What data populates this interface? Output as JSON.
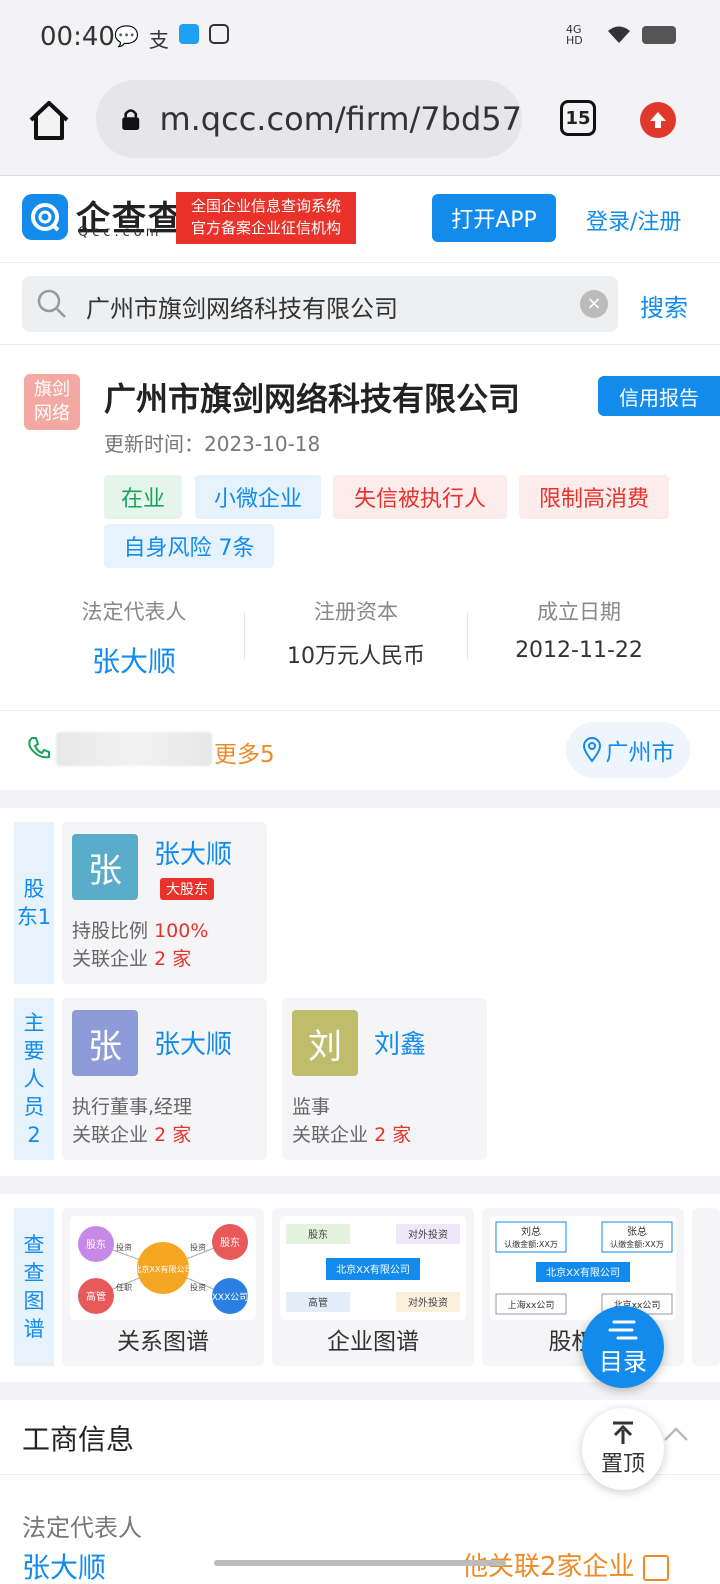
{
  "status_bar": {
    "time": "00:40",
    "network": "4G HD"
  },
  "browser": {
    "url": "m.qcc.com/firm/7bd57",
    "tab_count": "15"
  },
  "site": {
    "logo_text": "企查查",
    "logo_sub": "Qcc.com",
    "slogan_line1": "全国企业信息查询系统",
    "slogan_line2": "官方备案企业征信机构",
    "open_app": "打开APP",
    "login": "登录/注册"
  },
  "search": {
    "query": "广州市旗剑网络科技有限公司",
    "button": "搜索"
  },
  "company": {
    "logo_line1": "旗剑",
    "logo_line2": "网络",
    "name": "广州市旗剑网络科技有限公司",
    "credit_report": "信用报告",
    "update_label": "更新时间：",
    "update_date": "2023-10-18",
    "tags": [
      "在业",
      "小微企业",
      "失信被执行人",
      "限制高消费",
      "自身风险 7条"
    ],
    "legal_rep_label": "法定代表人",
    "legal_rep": "张大顺",
    "capital_label": "注册资本",
    "capital": "10万元人民币",
    "founded_label": "成立日期",
    "founded": "2012-11-22",
    "more_phones": "更多5",
    "city": "广州市"
  },
  "shareholders": {
    "label": "股\n东1",
    "items": [
      {
        "avatar": "张",
        "name": "张大顺",
        "badge": "大股东",
        "ratio_label": "持股比例",
        "ratio": "100%",
        "related_label": "关联企业",
        "related_count": "2 家"
      }
    ]
  },
  "key_people": {
    "label": "主\n要\n人\n员\n2",
    "items": [
      {
        "avatar": "张",
        "name": "张大顺",
        "role": "执行董事,经理",
        "related_label": "关联企业",
        "related_count": "2 家"
      },
      {
        "avatar": "刘",
        "name": "刘鑫",
        "role": "监事",
        "related_label": "关联企业",
        "related_count": "2 家"
      }
    ]
  },
  "graphs": {
    "label": "查\n查\n图\n谱",
    "items": [
      {
        "title": "关系图谱",
        "center": "北京XX有限公司",
        "n1": "股东",
        "n2": "高管",
        "n3": "股东",
        "n4": "XXX公司",
        "e1": "投资",
        "e2": "任职",
        "e3": "投资",
        "e4": "投资"
      },
      {
        "title": "企业图谱",
        "center": "北京XX有限公司",
        "n1": "股东",
        "n2": "对外投资",
        "n3": "高管",
        "n4": "对外投资"
      },
      {
        "title": "股权穿",
        "center": "北京XX有限公司",
        "n1": "刘总",
        "n1s": "认缴金额:XX万",
        "n2": "张总",
        "n2s": "认缴金额:XX万",
        "n3": "上海xx公司",
        "n4": "北京xx公司"
      }
    ]
  },
  "fab": {
    "catalog": "目录",
    "top": "置顶"
  },
  "business_info": {
    "title": "工商信息",
    "legal_rep_label": "法定代表人",
    "legal_rep": "张大顺",
    "related": "他关联2家企业"
  }
}
